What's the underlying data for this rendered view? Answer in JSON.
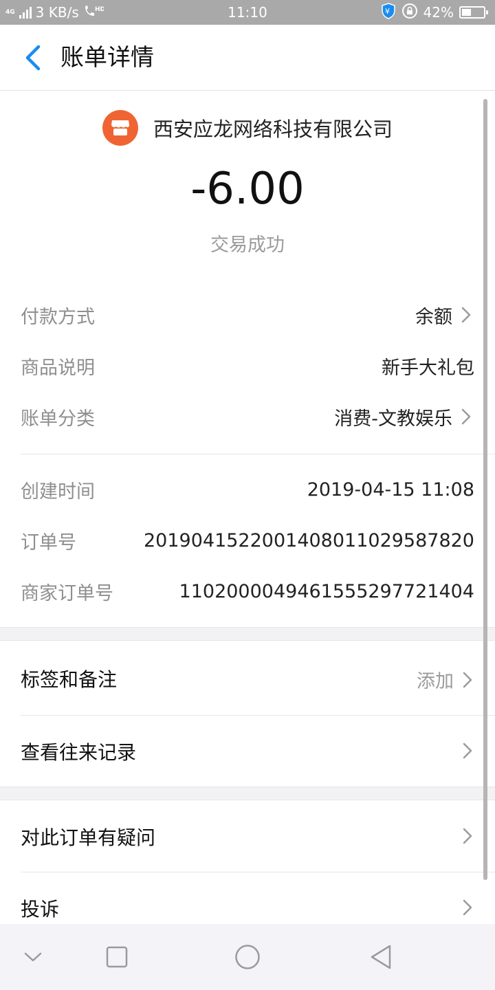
{
  "status_bar": {
    "network_type": "4G",
    "speed": "3 KB/s",
    "time": "11:10",
    "battery_percent": "42%",
    "battery_level": 0.42
  },
  "header": {
    "back_icon": "chevron-left-icon",
    "title": "账单详情"
  },
  "bill": {
    "merchant_icon": "shop-icon",
    "merchant_name": "西安应龙网络科技有限公司",
    "amount": "-6.00",
    "status": "交易成功",
    "rows_a": [
      {
        "label": "付款方式",
        "value": "余额"
      },
      {
        "label": "商品说明",
        "value": "新手大礼包"
      },
      {
        "label": "账单分类",
        "value": "消费-文教娱乐"
      }
    ],
    "rows_b": [
      {
        "label": "创建时间",
        "value": "2019-04-15 11:08"
      },
      {
        "label": "订单号",
        "value": "20190415220014080110295878​20"
      },
      {
        "label": "商家订单号",
        "value": "110200004946155529772140​4"
      }
    ]
  },
  "actions": {
    "tags_label": "标签和备注",
    "tags_value": "添加",
    "history_label": "查看往来记录",
    "question_label": "对此订单有疑问",
    "complain_label": "投诉"
  },
  "navbar": {
    "icons": [
      "chevron-down-icon",
      "recent-apps-icon",
      "home-icon",
      "back-triangle-icon"
    ]
  },
  "colors": {
    "accent": "#1a8cf0",
    "merchant_icon_bg": "#f06433",
    "status_bar_bg": "#a9a9a9",
    "label_gray": "#8f8f8f"
  }
}
